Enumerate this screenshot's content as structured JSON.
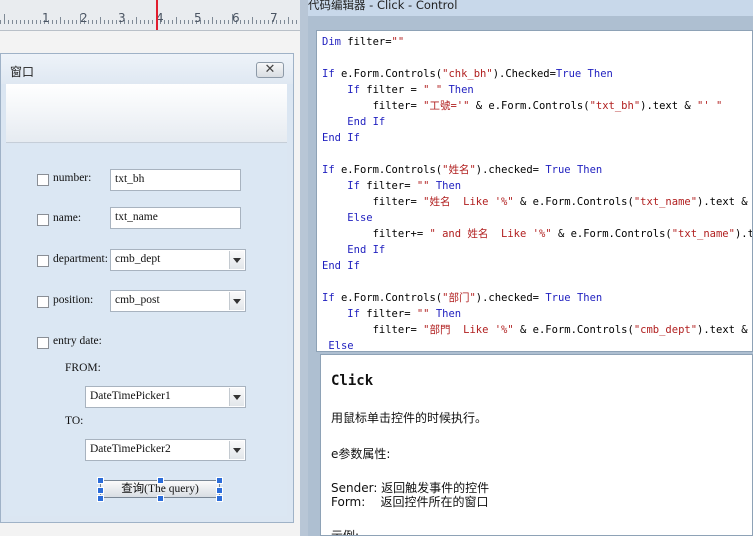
{
  "ruler": {
    "numbers": [
      "1",
      "2",
      "3",
      "4",
      "5",
      "6",
      "7"
    ]
  },
  "form": {
    "window_title": "窗口",
    "close_symbol": "✕",
    "fields": [
      {
        "label": "number:",
        "value": "txt_bh",
        "type": "text"
      },
      {
        "label": "name:",
        "value": "txt_name",
        "type": "text"
      },
      {
        "label": "department:",
        "value": "cmb_dept",
        "type": "combo"
      },
      {
        "label": "position:",
        "value": "cmb_post",
        "type": "combo"
      }
    ],
    "entry_date_label": "entry date:",
    "from_label": "FROM:",
    "to_label": "TO:",
    "dtp1": "DateTimePicker1",
    "dtp2": "DateTimePicker2",
    "query_button": "查询(The query)"
  },
  "editor": {
    "title": "代码编辑器 - Click - Control",
    "code_lines": [
      "Dim filter=\"\"",
      "",
      "If e.Form.Controls(\"chk_bh\").Checked=True Then",
      "    If filter = \" \" Then",
      "        filter= \"工號='\" & e.Form.Controls(\"txt_bh\").text & \"' \"",
      "    End If",
      "End If",
      "",
      "If e.Form.Controls(\"姓名\").checked= True Then",
      "    If filter= \"\" Then",
      "        filter= \"姓名  Like '%\" & e.Form.Controls(\"txt_name\").text & \"%'\"",
      "    Else",
      "        filter+= \" and 姓名  Like '%\" & e.Form.Controls(\"txt_name\").text",
      "    End If",
      "End If",
      "",
      "If e.Form.Controls(\"部门\").checked= True Then",
      "    If filter= \"\" Then",
      "        filter= \"部門  Like '%\" & e.Form.Controls(\"cmb_dept\").text & \"%'\"",
      " Else"
    ]
  },
  "help": {
    "title": "Click",
    "description": "用鼠标单击控件的时候执行。",
    "params_header": "e参数属性:",
    "sender_line": "Sender: 返回触发事件的控件",
    "form_line": "Form:    返回控件所在的窗口",
    "example_label": "示例:"
  }
}
